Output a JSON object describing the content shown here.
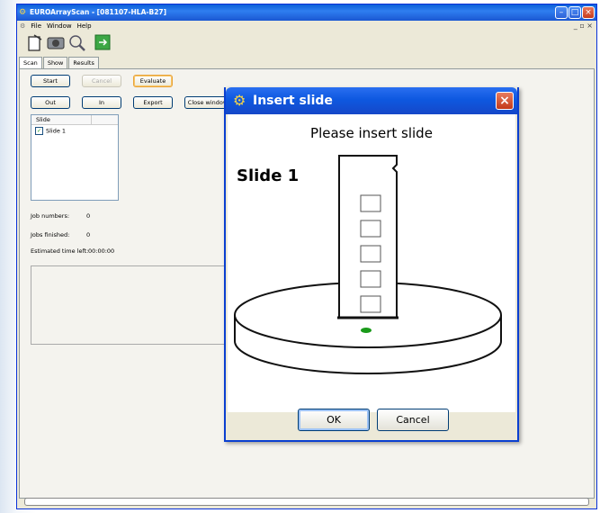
{
  "window": {
    "title": "EUROArrayScan - [081107-HLA-B27]",
    "menu": [
      "File",
      "Window",
      "Help"
    ],
    "mdi_controls": "_ &#x2752; ×"
  },
  "toolbar": {
    "icons": [
      "document-icon",
      "camera-icon",
      "magnifier-icon",
      "exit-icon"
    ]
  },
  "tabs": [
    "Scan",
    "Show",
    "Results"
  ],
  "scan": {
    "buttons": {
      "start": "Start",
      "cancel": "Cancel",
      "evaluate": "Evaluate",
      "out": "Out",
      "in": "In",
      "export": "Export",
      "close_window": "Close window"
    },
    "slide_list": {
      "header": "Slide",
      "items": [
        {
          "label": "Slide 1",
          "checked": true
        }
      ]
    },
    "job_numbers_label": "Job numbers:",
    "job_numbers_value": "0",
    "jobs_finished_label": "Jobs finished:",
    "jobs_finished_value": "0",
    "time_left_label": "Estimated time left:",
    "time_left_value": "00:00:00"
  },
  "progress": 0,
  "dialog": {
    "title": "Insert slide",
    "message": "Please insert slide",
    "slide_name": "Slide 1",
    "ok": "OK",
    "cancel": "Cancel",
    "field_count": 5
  },
  "colors": {
    "title_blue": "#0a5fd8",
    "close_red": "#c33a1a",
    "indicator_green": "#1a9a1a"
  }
}
